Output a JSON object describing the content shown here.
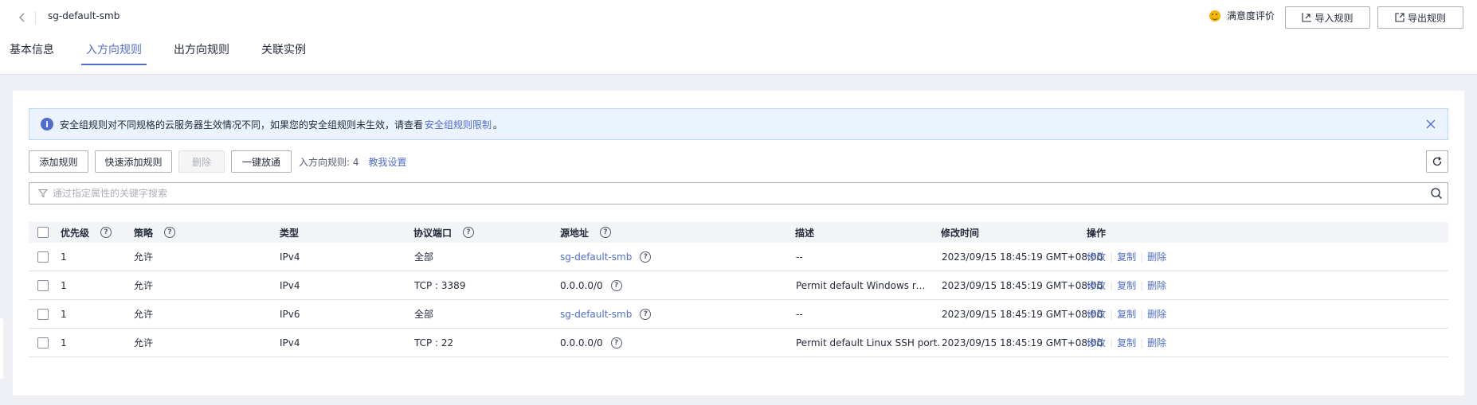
{
  "header": {
    "title": "sg-default-smb",
    "satisfaction_label": "满意度评价",
    "import_label": "导入规则",
    "export_label": "导出规则"
  },
  "tabs": [
    {
      "label": "基本信息",
      "active": false
    },
    {
      "label": "入方向规则",
      "active": true
    },
    {
      "label": "出方向规则",
      "active": false
    },
    {
      "label": "关联实例",
      "active": false
    }
  ],
  "alert": {
    "text": "安全组规则对不同规格的云服务器生效情况不同，如果您的安全组规则未生效，请查看",
    "link": "安全组规则限制",
    "suffix": "。"
  },
  "toolbar": {
    "add_label": "添加规则",
    "quick_add_label": "快速添加规则",
    "delete_label": "删除",
    "one_click_label": "一键放通",
    "rule_count_label": "入方向规则: 4",
    "teach_label": "教我设置"
  },
  "search": {
    "placeholder": "通过指定属性的关键字搜索"
  },
  "table": {
    "columns": [
      "优先级",
      "策略",
      "类型",
      "协议端口",
      "源地址",
      "描述",
      "修改时间",
      "操作"
    ],
    "rows": [
      {
        "priority": "1",
        "policy": "允许",
        "type": "IPv4",
        "port": "全部",
        "source": "sg-default-smb",
        "source_is_link": true,
        "desc": "--",
        "time": "2023/09/15 18:45:19 GMT+08:00"
      },
      {
        "priority": "1",
        "policy": "允许",
        "type": "IPv4",
        "port": "TCP : 3389",
        "source": "0.0.0.0/0",
        "source_is_link": false,
        "desc": "Permit default Windows remote d...",
        "time": "2023/09/15 18:45:19 GMT+08:00"
      },
      {
        "priority": "1",
        "policy": "允许",
        "type": "IPv6",
        "port": "全部",
        "source": "sg-default-smb",
        "source_is_link": true,
        "desc": "--",
        "time": "2023/09/15 18:45:19 GMT+08:00"
      },
      {
        "priority": "1",
        "policy": "允许",
        "type": "IPv4",
        "port": "TCP : 22",
        "source": "0.0.0.0/0",
        "source_is_link": false,
        "desc": "Permit default Linux SSH port.",
        "time": "2023/09/15 18:45:19 GMT+08:00"
      }
    ],
    "actions": {
      "modify": "修改",
      "copy": "复制",
      "delete": "删除"
    }
  },
  "colors": {
    "accent": "#526ecc",
    "border": "#adb0b8",
    "alert_bg": "#ebf3ff"
  }
}
